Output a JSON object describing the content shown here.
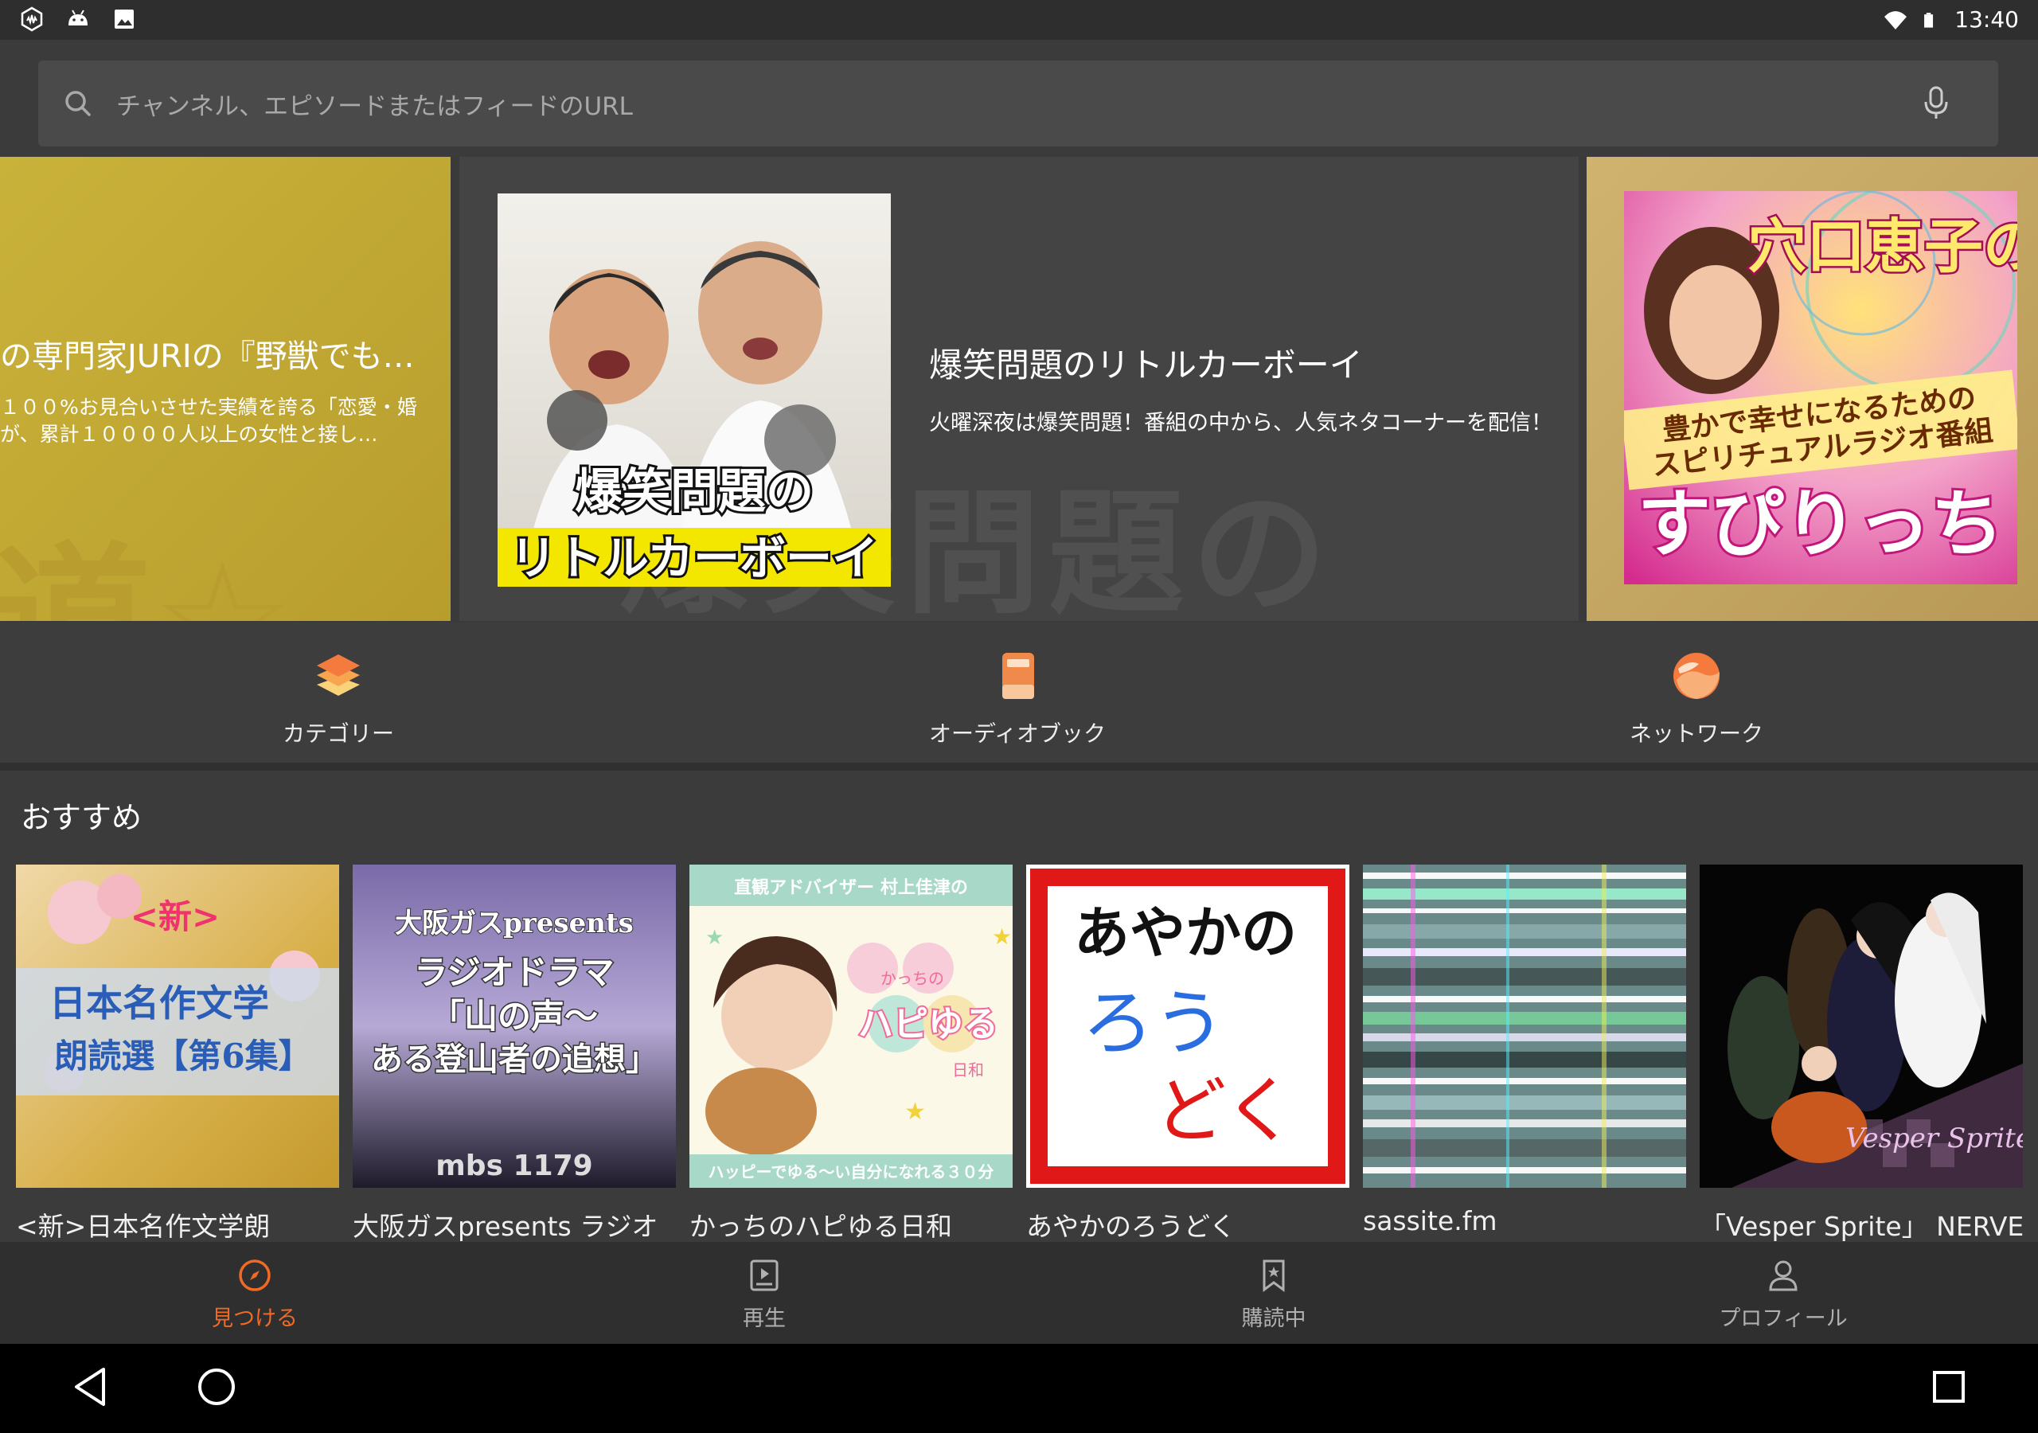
{
  "status": {
    "time": "13:40"
  },
  "search": {
    "placeholder": "チャンネル、エピソードまたはフィードのURL"
  },
  "banners": {
    "left": {
      "title": "の専門家JURIの『野獣でも…",
      "desc_line1": "１００%お見合いさせた実績を誇る「恋愛・婚",
      "desc_line2": "が、累計１００００人以上の女性と接し…",
      "deco": "道☆"
    },
    "middle": {
      "title": "爆笑問題のリトルカーボーイ",
      "desc": "火曜深夜は爆笑問題！番組の中から、人気ネタコーナーを配信！",
      "art_line1": "爆笑問題の",
      "art_line2": "リトルカーボーイ",
      "ghost_text": "爆笑問題の"
    },
    "right": {
      "art_line1": "穴口恵子の",
      "art_line2": "豊かで幸せになるための",
      "art_line3": "スピリチュアルラジオ番組",
      "art_line4": "すぴりっち"
    }
  },
  "quicknav": [
    {
      "label": "カテゴリー"
    },
    {
      "label": "オーディオブック"
    },
    {
      "label": "ネットワーク"
    }
  ],
  "recommend": {
    "title": "おすすめ",
    "items": [
      {
        "name": "<新>日本名作文学朗",
        "art_line1": "<新>",
        "art_line2": "日本名作文学",
        "art_line3": "朗読選【第6集】"
      },
      {
        "name": "大阪ガスpresents ラジオ",
        "art_line1": "大阪ガスpresents",
        "art_line2": "ラジオドラマ",
        "art_line3": "「山の声〜",
        "art_line4": "ある登山者の追想」",
        "art_line5": "mbs 1179"
      },
      {
        "name": "かっちのハピゆる日和",
        "art_top": "直観アドバイザー 村上佳津の",
        "art_mid1": "かっちの",
        "art_mid2": "ハピゆる",
        "art_mid3": "日和",
        "art_bottom": "ハッピーでゆる〜い自分になれる３０分"
      },
      {
        "name": "あやかのろうどく",
        "art_line1": "あやかの",
        "art_line2": "ろう",
        "art_line3": "どく"
      },
      {
        "name": "sassite.fm"
      },
      {
        "name": "「Vesper Sprite」 NERVE",
        "art_line1": "Vesper Sprite"
      }
    ]
  },
  "bottomnav": [
    {
      "label": "見つける"
    },
    {
      "label": "再生"
    },
    {
      "label": "購読中"
    },
    {
      "label": "プロフィール"
    }
  ],
  "colors": {
    "accent": "#f06a25",
    "background": "#3b3b3b"
  }
}
